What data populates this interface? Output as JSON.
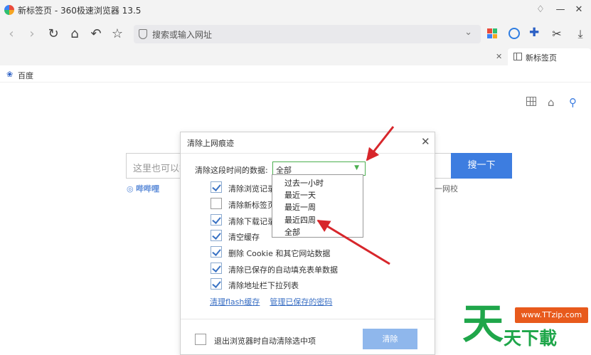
{
  "window": {
    "tab_title": "新标签页",
    "title": "新标签页 - 360极速浏览器 13.5"
  },
  "toolbar": {
    "address_placeholder": "搜索或输入网址"
  },
  "tabs": [
    {
      "label": "新标签页"
    }
  ],
  "bookmarks": [
    {
      "label": "百度"
    }
  ],
  "page": {
    "search_placeholder": "这里也可以搜",
    "search_button": "搜一下",
    "quick_left": "哔哔哩",
    "quick_right": "天一网校"
  },
  "dialog": {
    "title": "清除上网痕迹",
    "range_label": "清除这段时间的数据:",
    "range_selected": "全部",
    "options": [
      {
        "label": "清除浏览记录",
        "checked": true
      },
      {
        "label": "清除新标签页",
        "checked": false
      },
      {
        "label": "清除下载记录",
        "checked": true
      },
      {
        "label": "清空缓存",
        "checked": true
      },
      {
        "label": "删除 Cookie 和其它网站数据",
        "checked": true
      },
      {
        "label": "清除已保存的自动填充表单数据",
        "checked": true
      },
      {
        "label": "清除地址栏下拉列表",
        "checked": true
      }
    ],
    "links": [
      "清理flash缓存",
      "管理已保存的密码"
    ],
    "exit_option": "退出浏览器时自动清除选中项",
    "clear_button": "清除"
  },
  "dropdown": {
    "items": [
      "过去一小时",
      "最近一天",
      "最近一周",
      "最近四周",
      "全部"
    ]
  },
  "watermark": {
    "big": "天",
    "small": "天下載",
    "url": "www.TTzip.com"
  },
  "colors": {
    "accent": "#3d7de0",
    "arrow": "#d7262b",
    "select_border": "#4caf50",
    "watermark_green": "#1fa64a",
    "watermark_orange": "#e85a1c"
  },
  "icons": {
    "extensions": [
      "colored-grid-icon",
      "circle-icon",
      "puzzle-icon",
      "scissors-icon",
      "download-icon"
    ]
  }
}
